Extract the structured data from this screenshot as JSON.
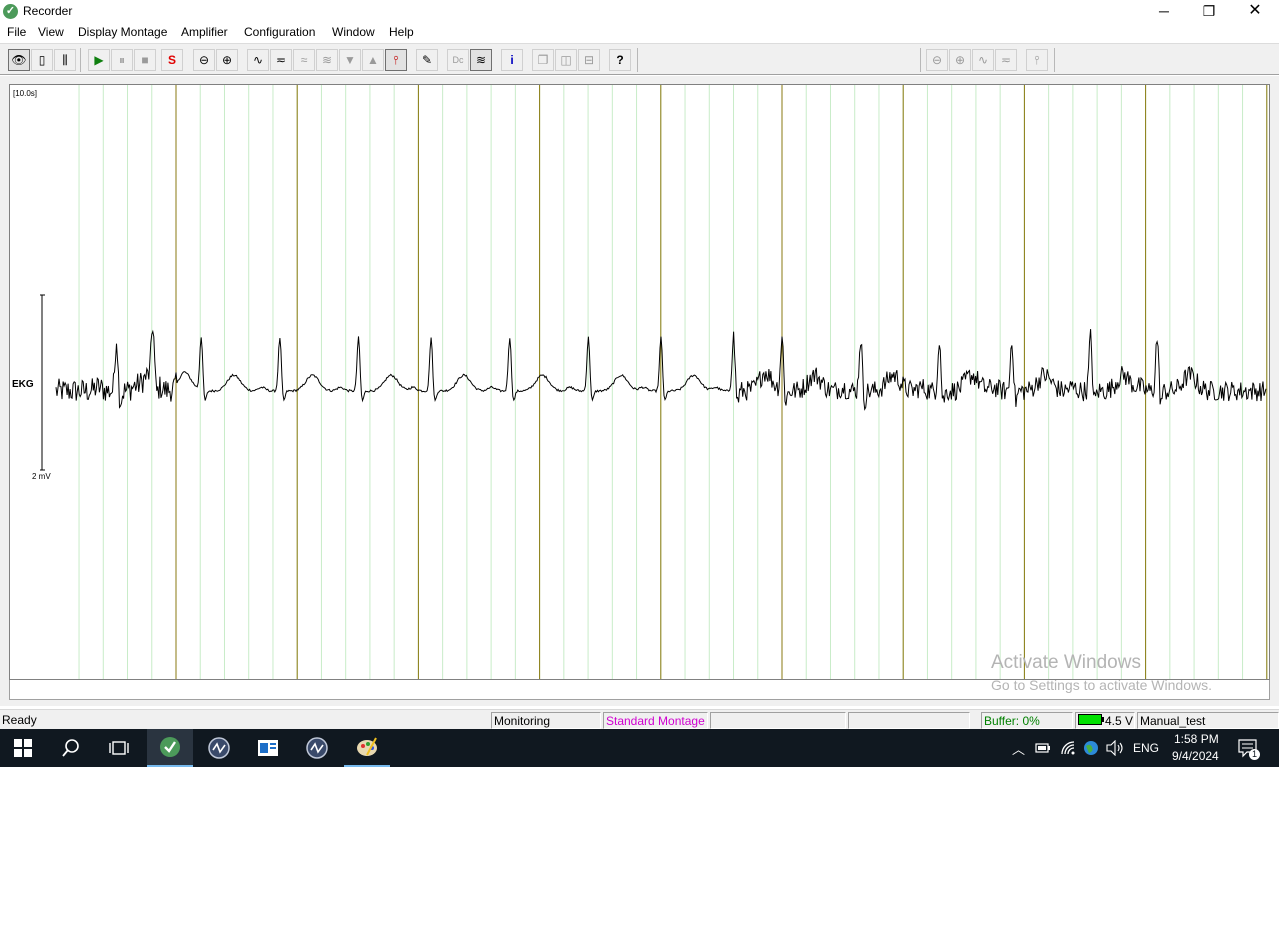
{
  "window": {
    "title": "Recorder",
    "minimize_glyph": "─",
    "maximize_glyph": "❐",
    "close_glyph": "✕",
    "app_icon_glyph": "✓"
  },
  "menu": [
    "File",
    "View",
    "Display Montage",
    "Amplifier",
    "Configuration",
    "Window",
    "Help"
  ],
  "toolbar": {
    "buttons": [
      {
        "icon": "eye-icon",
        "glyph": "👁"
      },
      {
        "icon": "single-channel-icon",
        "glyph": "▯"
      },
      {
        "icon": "multi-channel-icon",
        "glyph": "⫼"
      },
      {
        "icon": "play-icon",
        "glyph": "▶",
        "color": "#108010"
      },
      {
        "icon": "pause-icon",
        "glyph": "⏸"
      },
      {
        "icon": "stop-icon",
        "glyph": "■"
      },
      {
        "icon": "save-record-icon",
        "glyph": "S",
        "color": "#e00000"
      },
      {
        "icon": "zoom-out-icon",
        "glyph": "⊖"
      },
      {
        "icon": "zoom-in-icon",
        "glyph": "⊕"
      },
      {
        "icon": "waveform-icon",
        "glyph": "∿"
      },
      {
        "icon": "baseline-icon",
        "glyph": "≂"
      },
      {
        "icon": "filter-icon",
        "glyph": "≈"
      },
      {
        "icon": "stacked-wave-icon",
        "glyph": "≋"
      },
      {
        "icon": "scale-down-icon",
        "glyph": "▼"
      },
      {
        "icon": "scale-up-icon",
        "glyph": "▲"
      },
      {
        "icon": "marker-icon",
        "glyph": "⫯"
      },
      {
        "icon": "pencil-icon",
        "glyph": "✎"
      },
      {
        "icon": "dc-icon",
        "glyph": "Dc"
      },
      {
        "icon": "filter-wave-icon",
        "glyph": "≋"
      },
      {
        "icon": "info-icon",
        "glyph": "i",
        "color": "#0000c0"
      },
      {
        "icon": "layout-cascade-icon",
        "glyph": "❐"
      },
      {
        "icon": "layout-vertical-icon",
        "glyph": "◫"
      },
      {
        "icon": "layout-horizontal-icon",
        "glyph": "⊟"
      },
      {
        "icon": "help-icon",
        "glyph": "?"
      },
      {
        "icon": "zoom-out-secondary-icon",
        "glyph": "⊖"
      },
      {
        "icon": "zoom-in-secondary-icon",
        "glyph": "⊕"
      },
      {
        "icon": "waveform-secondary-icon",
        "glyph": "∿"
      },
      {
        "icon": "baseline-secondary-icon",
        "glyph": "≂"
      },
      {
        "icon": "marker-secondary-icon",
        "glyph": "⫯"
      }
    ]
  },
  "chart_data": {
    "type": "line",
    "window_label": "[10.0s]",
    "channel": "EKG",
    "scale_label": "2 mV",
    "grid": true,
    "major_divisions": 10,
    "minor_per_major": 5,
    "series": [
      {
        "name": "EKG",
        "color": "#000000",
        "segments": [
          {
            "start": 0.0,
            "end": 1.0,
            "noise": 0.55,
            "beats": [
              0.5,
              0.8
            ]
          },
          {
            "start": 1.0,
            "end": 5.6,
            "noise": 0.05,
            "beats": [
              1.2,
              1.85,
              2.5,
              3.1,
              3.75,
              4.4,
              5.0,
              5.6
            ]
          },
          {
            "start": 5.6,
            "end": 10.0,
            "noise": 0.45,
            "beats": [
              6.0,
              6.65,
              7.3,
              7.9,
              8.55,
              9.1
            ]
          }
        ],
        "r_amplitude_mv": 1.2,
        "t_amplitude_mv": 0.35
      }
    ]
  },
  "watermark": {
    "line1": "Activate Windows",
    "line2": "Go to Settings to activate Windows."
  },
  "status": {
    "ready": "Ready",
    "mode": "Monitoring",
    "montage": "Standard Montage",
    "buffer": "Buffer: 0%",
    "voltage": "4.5 V",
    "file": "Manual_test",
    "montage_color": "#d000d0",
    "buffer_color": "#008000"
  },
  "taskbar": {
    "start_glyph": "⊞",
    "search_glyph": "⌕",
    "taskview_glyph": "❏",
    "overflow_glyph": "︿",
    "language": "ENG",
    "time": "1:58 PM",
    "date": "9/4/2024",
    "notification_count": "1"
  }
}
